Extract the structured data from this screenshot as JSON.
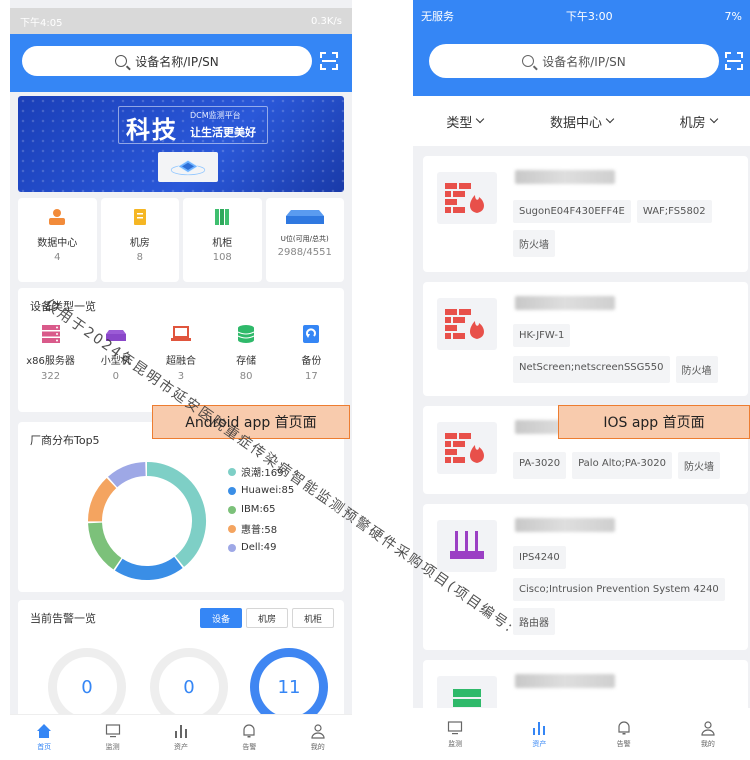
{
  "android": {
    "status": {
      "time": "下午4:05",
      "info": "0.3K/s"
    },
    "search": {
      "placeholder": "设备名称/IP/SN"
    },
    "banner": {
      "title": "科技",
      "sub1": "DCM监测平台",
      "sub2": "让生活更美好"
    },
    "stats": [
      {
        "label": "数据中心",
        "value": "4"
      },
      {
        "label": "机房",
        "value": "8"
      },
      {
        "label": "机柜",
        "value": "108"
      },
      {
        "label": "U位(可用/总共)",
        "value": "2988/4551"
      }
    ],
    "types": {
      "title": "设备类型一览",
      "items": [
        {
          "label": "x86服务器",
          "value": "322"
        },
        {
          "label": "小型机",
          "value": "0"
        },
        {
          "label": "超融合",
          "value": "3"
        },
        {
          "label": "存储",
          "value": "80"
        },
        {
          "label": "备份",
          "value": "17"
        }
      ]
    },
    "vendor": {
      "title": "厂商分布Top5"
    },
    "alarm": {
      "title": "当前告警一览",
      "tabs": [
        "设备",
        "机房",
        "机柜"
      ],
      "gauges": [
        "0",
        "0",
        "11"
      ]
    },
    "nav": [
      "首页",
      "监测",
      "资产",
      "告警",
      "我的"
    ]
  },
  "chart_data": {
    "type": "pie",
    "title": "厂商分布Top5",
    "categories": [
      "浪潮",
      "Huawei",
      "IBM",
      "惠普",
      "Dell"
    ],
    "legend_labels": [
      "浪潮:169",
      "Huawei:85",
      "IBM:65",
      "惠普:58",
      "Dell:49"
    ],
    "values": [
      169,
      85,
      65,
      58,
      49
    ],
    "colors": [
      "#7ecfc6",
      "#3a8ee6",
      "#7cc17a",
      "#f4a460",
      "#9ea8e6"
    ],
    "legend_position": "right"
  },
  "ios": {
    "status": {
      "carrier": "无服务",
      "time": "下午3:00",
      "battery": "7%"
    },
    "search": {
      "placeholder": "设备名称/IP/SN"
    },
    "filters": [
      "类型",
      "数据中心",
      "机房"
    ],
    "devices": [
      {
        "lines": [
          [
            "SugonE04F430EFF4E",
            "WAF;FS5802"
          ],
          [
            "防火墙"
          ]
        ]
      },
      {
        "lines": [
          [
            "HK-JFW-1"
          ],
          [
            "NetScreen;netscreenSSG550",
            "防火墙"
          ]
        ]
      },
      {
        "lines": [
          [
            "PA-3020",
            "Palo Alto;PA-3020",
            "防火墙"
          ]
        ]
      },
      {
        "lines": [
          [
            "IPS4240"
          ],
          [
            "Cisco;Intrusion Prevention System 4240"
          ],
          [
            "路由器"
          ]
        ]
      }
    ],
    "nav": [
      "监测",
      "资产",
      "告警",
      "我的"
    ]
  },
  "callouts": {
    "android": "Android app 首页面",
    "ios": "IOS app 首页面"
  },
  "watermark": "仅用于2024年昆明市延安医院重症传染病智能监测预警硬件采购项目(项目编号:"
}
